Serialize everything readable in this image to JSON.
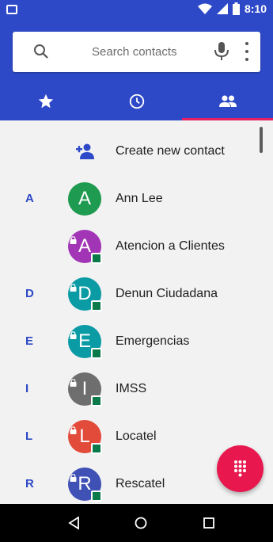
{
  "status_bar": {
    "time": "8:10"
  },
  "search": {
    "placeholder": "Search contacts"
  },
  "tabs": [
    {
      "icon": "star-icon",
      "label": "Favorites"
    },
    {
      "icon": "clock-icon",
      "label": "Recents"
    },
    {
      "icon": "people-icon",
      "label": "Contacts"
    }
  ],
  "create_contact": {
    "label": "Create new contact"
  },
  "contacts": [
    {
      "letter": "A",
      "initial": "A",
      "name": "Ann Lee",
      "color": "#1e9b50",
      "managed": false
    },
    {
      "letter": "",
      "initial": "A",
      "name": "Atencion a Clientes",
      "color": "#a235b5",
      "managed": true
    },
    {
      "letter": "D",
      "initial": "D",
      "name": "Denun Ciudadana",
      "color": "#0a9ba5",
      "managed": true
    },
    {
      "letter": "E",
      "initial": "E",
      "name": "Emergencias",
      "color": "#0a9ba5",
      "managed": true
    },
    {
      "letter": "I",
      "initial": "I",
      "name": "IMSS",
      "color": "#6e6e6e",
      "managed": true
    },
    {
      "letter": "L",
      "initial": "L",
      "name": "Locatel",
      "color": "#e24a3a",
      "managed": true
    },
    {
      "letter": "R",
      "initial": "R",
      "name": "Rescatel",
      "color": "#3f51b5",
      "managed": true
    }
  ],
  "colors": {
    "primary": "#2e49c7",
    "accent": "#e91e63",
    "fab": "#e8184f"
  }
}
